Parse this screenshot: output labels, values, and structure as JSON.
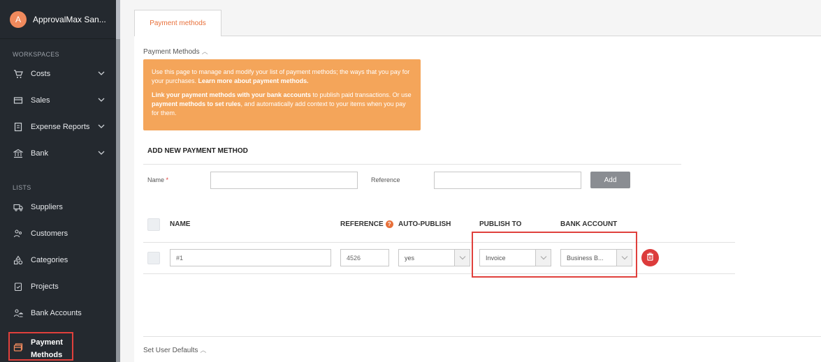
{
  "org": {
    "initial": "A",
    "name": "ApprovalMax San..."
  },
  "sidebar": {
    "workspaces_title": "WORKSPACES",
    "workspaces": [
      {
        "label": "Costs",
        "icon": "cart-icon"
      },
      {
        "label": "Sales",
        "icon": "wallet-icon"
      },
      {
        "label": "Expense Reports",
        "icon": "receipt-icon"
      },
      {
        "label": "Bank",
        "icon": "bank-icon"
      }
    ],
    "lists_title": "LISTS",
    "lists": [
      {
        "label": "Suppliers",
        "icon": "truck-icon"
      },
      {
        "label": "Customers",
        "icon": "customers-icon"
      },
      {
        "label": "Categories",
        "icon": "categories-icon"
      },
      {
        "label": "Projects",
        "icon": "projects-icon"
      },
      {
        "label": "Bank Accounts",
        "icon": "bank-accounts-icon"
      }
    ],
    "active": {
      "label_line1": "Payment",
      "label_line2": "Methods",
      "icon": "payment-methods-icon"
    }
  },
  "tab": {
    "label": "Payment methods"
  },
  "section": {
    "title": "Payment Methods"
  },
  "info": {
    "p1_text": "Use this page to manage and modify your list of payment methods; the ways that you pay for your purchases. ",
    "p1_link": "Learn more about payment methods.",
    "p2_link1": "Link your payment methods with your bank accounts",
    "p2_text1": " to publish paid transactions. Or use ",
    "p2_link2": "payment methods to set rules",
    "p2_text2": ", and automatically add context to your items when you pay for them."
  },
  "add_form": {
    "title": "ADD NEW PAYMENT METHOD",
    "name_label": "Name",
    "required_mark": "*",
    "name_value": "",
    "reference_label": "Reference",
    "reference_value": "",
    "add_button": "Add"
  },
  "table": {
    "headers": {
      "name": "NAME",
      "reference": "REFERENCE",
      "reference_help": "?",
      "auto_publish": "AUTO-PUBLISH",
      "publish_to": "PUBLISH TO",
      "bank_account": "BANK ACCOUNT"
    },
    "rows": [
      {
        "name": "#1",
        "reference": "4526",
        "auto_publish": "yes",
        "publish_to": "Invoice",
        "bank_account": "Business B..."
      }
    ]
  },
  "defaults_section": {
    "title": "Set User Defaults"
  },
  "colors": {
    "accent": "#e8703a",
    "info_bg": "#f4a55a",
    "highlight": "#e0403c",
    "sidebar_bg": "#24292f"
  }
}
